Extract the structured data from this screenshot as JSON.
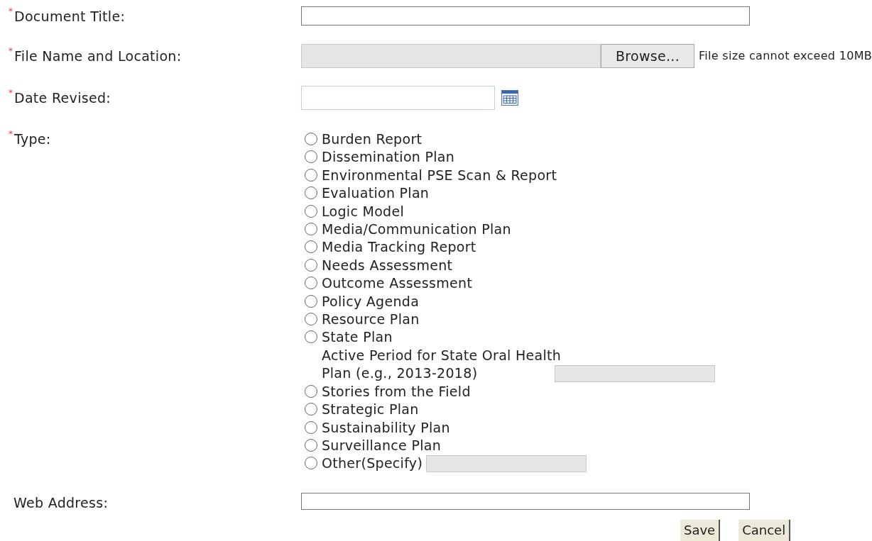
{
  "fields": [
    {
      "kind": "text",
      "label": "Document Title:",
      "marker": "*"
    },
    {
      "kind": "file",
      "label": "File Name and Location:",
      "marker": "*",
      "button": "Browse...",
      "note": "File size cannot exceed 10MB"
    },
    {
      "kind": "date",
      "label": "Date Revised:",
      "marker": "*"
    },
    {
      "kind": "radio",
      "label": "Type:",
      "marker": "*",
      "options": [
        {
          "kind": "plain",
          "label": "Burden Report",
          "selected": false
        },
        {
          "kind": "plain",
          "label": "Dissemination Plan",
          "selected": false
        },
        {
          "kind": "plain",
          "label": "Environmental PSE Scan & Report",
          "selected": false
        },
        {
          "kind": "plain",
          "label": "Evaluation Plan",
          "selected": false
        },
        {
          "kind": "plain",
          "label": "Logic Model",
          "selected": false
        },
        {
          "kind": "plain",
          "label": "Media/Communication Plan",
          "selected": false
        },
        {
          "kind": "plain",
          "label": "Media Tracking Report",
          "selected": false
        },
        {
          "kind": "plain",
          "label": "Needs Assessment",
          "selected": false
        },
        {
          "kind": "plain",
          "label": "Outcome Assessment",
          "selected": false
        },
        {
          "kind": "plain",
          "label": "Policy Agenda",
          "selected": false
        },
        {
          "kind": "plain",
          "label": "Resource Plan",
          "selected": false
        },
        {
          "kind": "below",
          "label": "State Plan",
          "selected": false,
          "detail": "Active Period for State Oral Health Plan (e.g., 2013-2018)"
        },
        {
          "kind": "plain",
          "label": "Stories from the Field",
          "selected": false
        },
        {
          "kind": "plain",
          "label": "Strategic Plan",
          "selected": false
        },
        {
          "kind": "plain",
          "label": "Sustainability Plan",
          "selected": false
        },
        {
          "kind": "plain",
          "label": "Surveillance Plan",
          "selected": false
        },
        {
          "kind": "inline",
          "label": "Other(Specify)",
          "selected": false
        }
      ]
    },
    {
      "kind": "text",
      "label": "Web Address:"
    }
  ],
  "buttons": [
    "Save",
    "Cancel"
  ]
}
